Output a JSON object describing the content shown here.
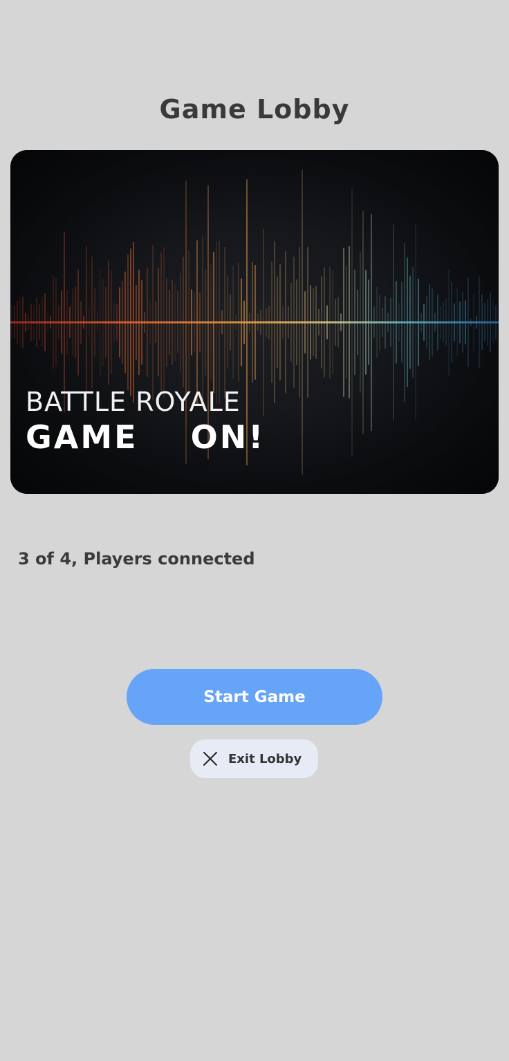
{
  "header": {
    "title": "Game Lobby"
  },
  "banner": {
    "subtitle": "BATTLE ROYALE",
    "headline": "GAME    ON!"
  },
  "lobby": {
    "status_text": "3 of 4, Players connected"
  },
  "actions": {
    "start_label": "Start Game",
    "exit_label": "Exit Lobby",
    "exit_icon": "close-icon"
  },
  "colors": {
    "background": "#d6d6d7",
    "primary_button": "#66a4f7",
    "secondary_button": "#e6ebf5",
    "text": "#3a3a3a"
  }
}
